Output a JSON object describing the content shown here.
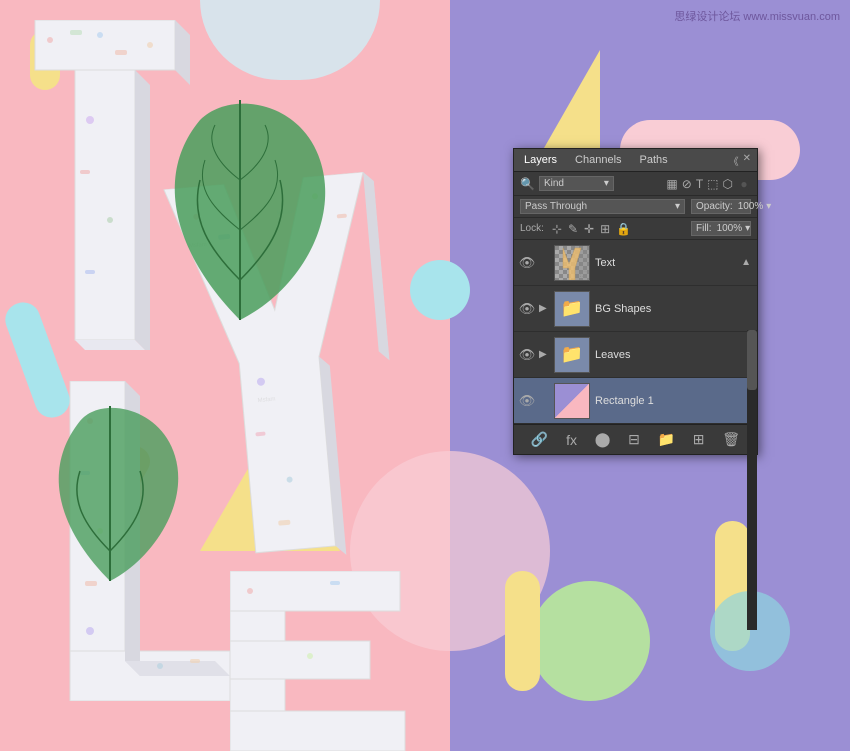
{
  "watermark": {
    "text": "思绿设计论坛 www.missvuan.com"
  },
  "canvas": {
    "bg_left_color": "#f9b8c0",
    "bg_right_color": "#9b8fd4"
  },
  "panel": {
    "tabs": [
      {
        "label": "Layers",
        "active": true
      },
      {
        "label": "Channels",
        "active": false
      },
      {
        "label": "Paths",
        "active": false
      }
    ],
    "filter_label": "Kind",
    "blend_mode": "Pass Through",
    "opacity_label": "Opacity:",
    "opacity_value": "100%",
    "lock_label": "Lock:",
    "fill_label": "Fill:",
    "fill_value": "100%",
    "layers": [
      {
        "id": "text-layer",
        "name": "Text",
        "type": "layer",
        "visible": true,
        "selected": false,
        "has_mask": true,
        "has_effect": false,
        "expand": false
      },
      {
        "id": "bg-shapes-layer",
        "name": "BG Shapes",
        "type": "group",
        "visible": true,
        "selected": false,
        "has_mask": false,
        "has_effect": false,
        "expand": true
      },
      {
        "id": "leaves-layer",
        "name": "Leaves",
        "type": "group",
        "visible": true,
        "selected": false,
        "has_mask": false,
        "has_effect": false,
        "expand": true
      },
      {
        "id": "rectangle1-layer",
        "name": "Rectangle 1",
        "type": "layer",
        "visible": true,
        "selected": false,
        "has_mask": true,
        "has_effect": false,
        "expand": false
      }
    ],
    "toolbar_buttons": [
      "link",
      "fx",
      "adjustment",
      "mask",
      "folder",
      "artboard",
      "trash"
    ]
  }
}
